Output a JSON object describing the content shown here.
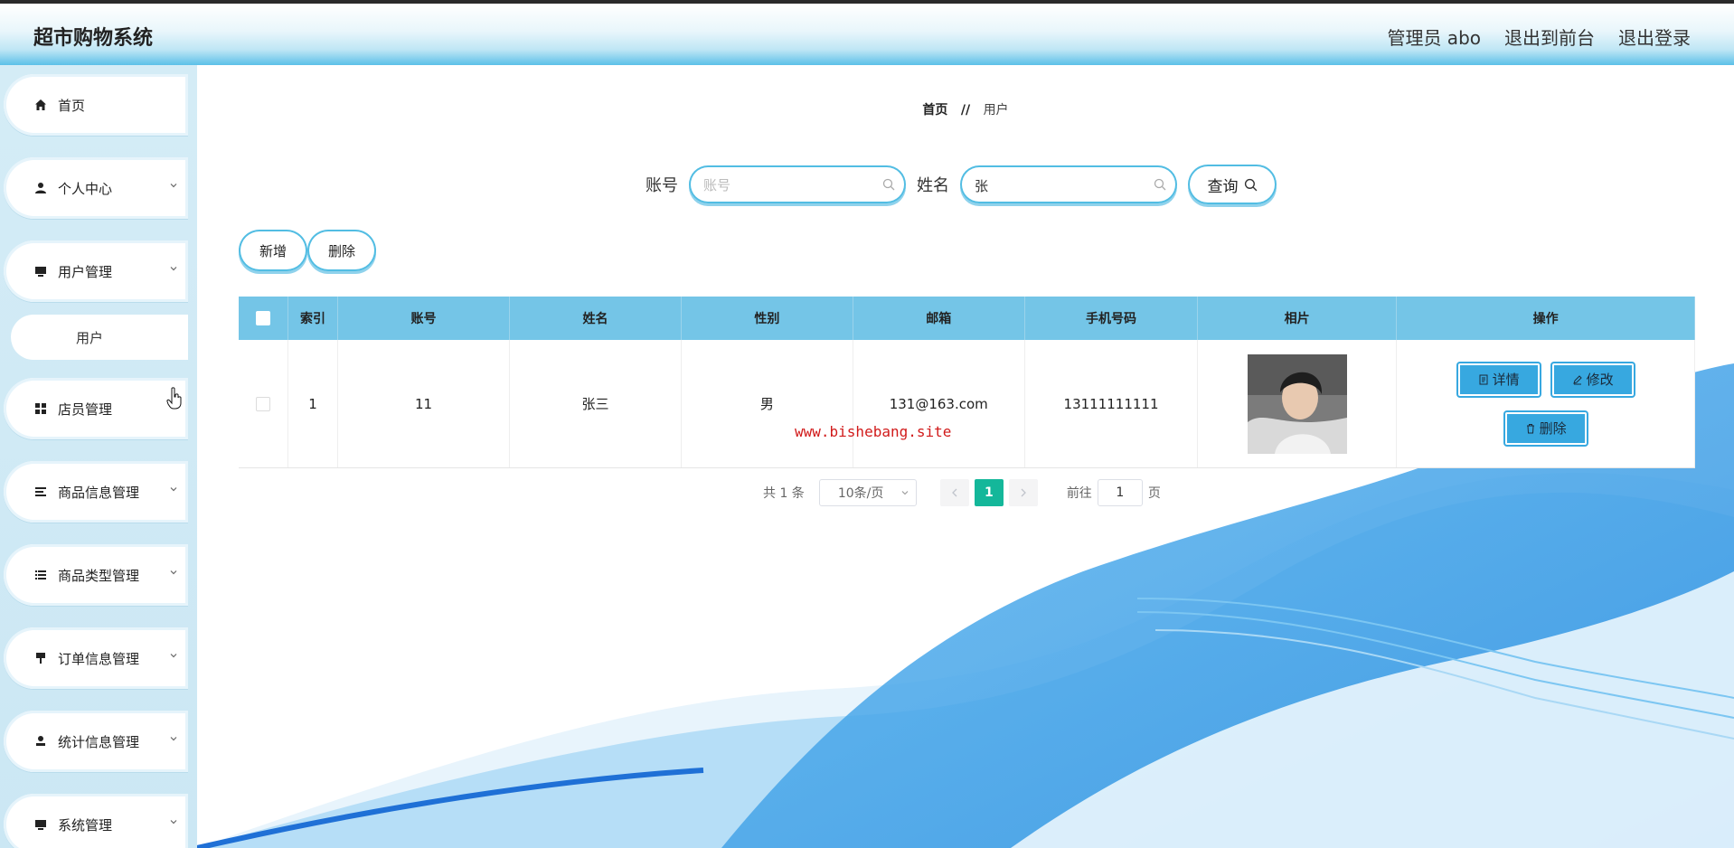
{
  "app": {
    "title": "超市购物系统"
  },
  "header": {
    "user_label": "管理员 abo",
    "front_label": "退出到前台",
    "logout_label": "退出登录"
  },
  "sidebar": {
    "items": [
      {
        "label": "首页",
        "icon": "home-icon",
        "has_arrow": false
      },
      {
        "label": "个人中心",
        "icon": "person-icon",
        "has_arrow": true
      },
      {
        "label": "用户管理",
        "icon": "monitor-icon",
        "has_arrow": true,
        "children": [
          {
            "label": "用户"
          }
        ]
      },
      {
        "label": "店员管理",
        "icon": "grid-icon",
        "has_arrow": false
      },
      {
        "label": "商品信息管理",
        "icon": "list-icon",
        "has_arrow": true
      },
      {
        "label": "商品类型管理",
        "icon": "list-icon",
        "has_arrow": true
      },
      {
        "label": "订单信息管理",
        "icon": "brush-icon",
        "has_arrow": true
      },
      {
        "label": "统计信息管理",
        "icon": "user-stand-icon",
        "has_arrow": true
      },
      {
        "label": "系统管理",
        "icon": "monitor-icon",
        "has_arrow": true
      }
    ]
  },
  "breadcrumb": {
    "home": "首页",
    "separator": "//",
    "current": "用户"
  },
  "search": {
    "account_label": "账号",
    "account_placeholder": "账号",
    "account_value": "",
    "name_label": "姓名",
    "name_value": "张",
    "query_label": "查询"
  },
  "actions": {
    "add_label": "新增",
    "delete_label": "删除"
  },
  "table": {
    "headers": [
      "索引",
      "账号",
      "姓名",
      "性别",
      "邮箱",
      "手机号码",
      "相片",
      "操作"
    ],
    "rows": [
      {
        "index": "1",
        "account": "11",
        "name": "张三",
        "gender": "男",
        "email": "131@163.com",
        "phone": "13111111111"
      }
    ],
    "row_actions": {
      "detail": "详情",
      "edit": "修改",
      "delete": "删除"
    }
  },
  "pagination": {
    "total": "共 1 条",
    "page_size": "10条/页",
    "current_page": "1",
    "goto_label": "前往",
    "goto_value": "1",
    "page_suffix": "页"
  },
  "watermark": "www.bishebang.site",
  "colors": {
    "accent": "#37a8e0",
    "header_blue": "#74c5e7",
    "pager_active": "#14b79a"
  }
}
